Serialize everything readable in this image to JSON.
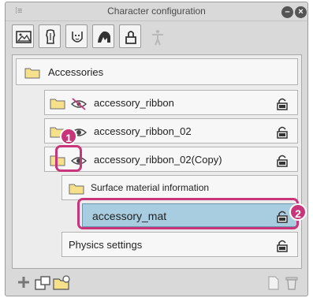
{
  "window": {
    "title": "Character configuration",
    "grip_glyph": "⁞≡",
    "minimize_glyph": "–",
    "close_glyph": "×"
  },
  "toolbar": {
    "tools": [
      {
        "icon": "scene-icon",
        "enabled": true
      },
      {
        "icon": "body-shape-icon",
        "enabled": true
      },
      {
        "icon": "face-icon",
        "enabled": true
      },
      {
        "icon": "hair-icon",
        "enabled": true
      },
      {
        "icon": "accessory-icon",
        "enabled": true,
        "active": true
      },
      {
        "icon": "pose-figure-icon",
        "enabled": false
      }
    ]
  },
  "tree": {
    "root": {
      "label": "Accessories",
      "icon": "folder-icon"
    },
    "items": [
      {
        "label": "accessory_ribbon",
        "visibility": "hidden",
        "locked": true
      },
      {
        "label": "accessory_ribbon_02",
        "visibility": "visible",
        "locked": true
      },
      {
        "label": "accessory_ribbon_02(Copy)",
        "visibility": "visible",
        "locked": true
      },
      {
        "label": "Surface material information",
        "type": "folder"
      },
      {
        "label": "accessory_mat",
        "selected": true,
        "locked": true
      },
      {
        "label": "Physics settings",
        "locked": true
      }
    ]
  },
  "callouts": [
    {
      "number": "1",
      "color": "#c8357a"
    },
    {
      "number": "2",
      "color": "#c8357a"
    }
  ],
  "colors": {
    "accent": "#c8357a",
    "selection": "#a9cde0",
    "panel": "#d9d9d9"
  }
}
